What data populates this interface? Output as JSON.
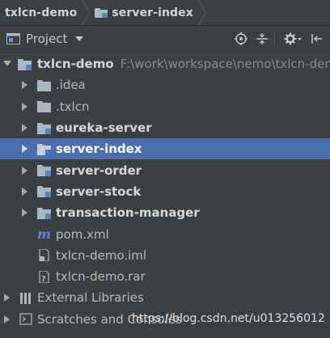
{
  "breadcrumb": {
    "items": [
      "txlcn-demo",
      "server-index"
    ]
  },
  "toolbar": {
    "title": "Project",
    "icons": [
      "chevron-down-icon",
      "target-icon",
      "collapse-icon",
      "gear-icon",
      "hide-icon"
    ]
  },
  "tree": {
    "root": {
      "label": "txlcn-demo",
      "path": "F:\\work\\workspace\\nemo\\txlcn-dem"
    },
    "items": [
      {
        "label": ".idea"
      },
      {
        "label": ".txlcn"
      },
      {
        "label": "eureka-server"
      },
      {
        "label": "server-index"
      },
      {
        "label": "server-order"
      },
      {
        "label": "server-stock"
      },
      {
        "label": "transaction-manager"
      },
      {
        "label": "pom.xml"
      },
      {
        "label": "txlcn-demo.iml"
      },
      {
        "label": "txlcn-demo.rar"
      }
    ],
    "external_libraries": "External Libraries",
    "scratches": "Scratches and Consoles",
    "selected": "server-index"
  },
  "watermark": "https://blog.csdn.net/u013256012",
  "colors": {
    "background": "#3c3f41",
    "selection": "#4b6eaf",
    "folder": "#a9b7c6",
    "maven": "#5b8bd6"
  }
}
